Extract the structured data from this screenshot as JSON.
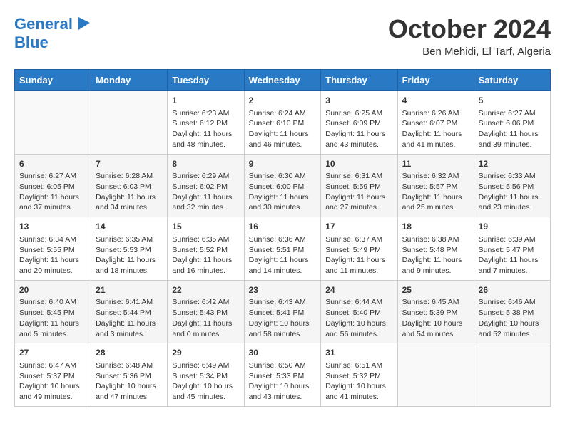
{
  "logo": {
    "line1": "General",
    "line2": "Blue"
  },
  "title": "October 2024",
  "location": "Ben Mehidi, El Tarf, Algeria",
  "weekdays": [
    "Sunday",
    "Monday",
    "Tuesday",
    "Wednesday",
    "Thursday",
    "Friday",
    "Saturday"
  ],
  "weeks": [
    [
      {
        "day": "",
        "info": ""
      },
      {
        "day": "",
        "info": ""
      },
      {
        "day": "1",
        "info": "Sunrise: 6:23 AM\nSunset: 6:12 PM\nDaylight: 11 hours and 48 minutes."
      },
      {
        "day": "2",
        "info": "Sunrise: 6:24 AM\nSunset: 6:10 PM\nDaylight: 11 hours and 46 minutes."
      },
      {
        "day": "3",
        "info": "Sunrise: 6:25 AM\nSunset: 6:09 PM\nDaylight: 11 hours and 43 minutes."
      },
      {
        "day": "4",
        "info": "Sunrise: 6:26 AM\nSunset: 6:07 PM\nDaylight: 11 hours and 41 minutes."
      },
      {
        "day": "5",
        "info": "Sunrise: 6:27 AM\nSunset: 6:06 PM\nDaylight: 11 hours and 39 minutes."
      }
    ],
    [
      {
        "day": "6",
        "info": "Sunrise: 6:27 AM\nSunset: 6:05 PM\nDaylight: 11 hours and 37 minutes."
      },
      {
        "day": "7",
        "info": "Sunrise: 6:28 AM\nSunset: 6:03 PM\nDaylight: 11 hours and 34 minutes."
      },
      {
        "day": "8",
        "info": "Sunrise: 6:29 AM\nSunset: 6:02 PM\nDaylight: 11 hours and 32 minutes."
      },
      {
        "day": "9",
        "info": "Sunrise: 6:30 AM\nSunset: 6:00 PM\nDaylight: 11 hours and 30 minutes."
      },
      {
        "day": "10",
        "info": "Sunrise: 6:31 AM\nSunset: 5:59 PM\nDaylight: 11 hours and 27 minutes."
      },
      {
        "day": "11",
        "info": "Sunrise: 6:32 AM\nSunset: 5:57 PM\nDaylight: 11 hours and 25 minutes."
      },
      {
        "day": "12",
        "info": "Sunrise: 6:33 AM\nSunset: 5:56 PM\nDaylight: 11 hours and 23 minutes."
      }
    ],
    [
      {
        "day": "13",
        "info": "Sunrise: 6:34 AM\nSunset: 5:55 PM\nDaylight: 11 hours and 20 minutes."
      },
      {
        "day": "14",
        "info": "Sunrise: 6:35 AM\nSunset: 5:53 PM\nDaylight: 11 hours and 18 minutes."
      },
      {
        "day": "15",
        "info": "Sunrise: 6:35 AM\nSunset: 5:52 PM\nDaylight: 11 hours and 16 minutes."
      },
      {
        "day": "16",
        "info": "Sunrise: 6:36 AM\nSunset: 5:51 PM\nDaylight: 11 hours and 14 minutes."
      },
      {
        "day": "17",
        "info": "Sunrise: 6:37 AM\nSunset: 5:49 PM\nDaylight: 11 hours and 11 minutes."
      },
      {
        "day": "18",
        "info": "Sunrise: 6:38 AM\nSunset: 5:48 PM\nDaylight: 11 hours and 9 minutes."
      },
      {
        "day": "19",
        "info": "Sunrise: 6:39 AM\nSunset: 5:47 PM\nDaylight: 11 hours and 7 minutes."
      }
    ],
    [
      {
        "day": "20",
        "info": "Sunrise: 6:40 AM\nSunset: 5:45 PM\nDaylight: 11 hours and 5 minutes."
      },
      {
        "day": "21",
        "info": "Sunrise: 6:41 AM\nSunset: 5:44 PM\nDaylight: 11 hours and 3 minutes."
      },
      {
        "day": "22",
        "info": "Sunrise: 6:42 AM\nSunset: 5:43 PM\nDaylight: 11 hours and 0 minutes."
      },
      {
        "day": "23",
        "info": "Sunrise: 6:43 AM\nSunset: 5:41 PM\nDaylight: 10 hours and 58 minutes."
      },
      {
        "day": "24",
        "info": "Sunrise: 6:44 AM\nSunset: 5:40 PM\nDaylight: 10 hours and 56 minutes."
      },
      {
        "day": "25",
        "info": "Sunrise: 6:45 AM\nSunset: 5:39 PM\nDaylight: 10 hours and 54 minutes."
      },
      {
        "day": "26",
        "info": "Sunrise: 6:46 AM\nSunset: 5:38 PM\nDaylight: 10 hours and 52 minutes."
      }
    ],
    [
      {
        "day": "27",
        "info": "Sunrise: 6:47 AM\nSunset: 5:37 PM\nDaylight: 10 hours and 49 minutes."
      },
      {
        "day": "28",
        "info": "Sunrise: 6:48 AM\nSunset: 5:36 PM\nDaylight: 10 hours and 47 minutes."
      },
      {
        "day": "29",
        "info": "Sunrise: 6:49 AM\nSunset: 5:34 PM\nDaylight: 10 hours and 45 minutes."
      },
      {
        "day": "30",
        "info": "Sunrise: 6:50 AM\nSunset: 5:33 PM\nDaylight: 10 hours and 43 minutes."
      },
      {
        "day": "31",
        "info": "Sunrise: 6:51 AM\nSunset: 5:32 PM\nDaylight: 10 hours and 41 minutes."
      },
      {
        "day": "",
        "info": ""
      },
      {
        "day": "",
        "info": ""
      }
    ]
  ]
}
